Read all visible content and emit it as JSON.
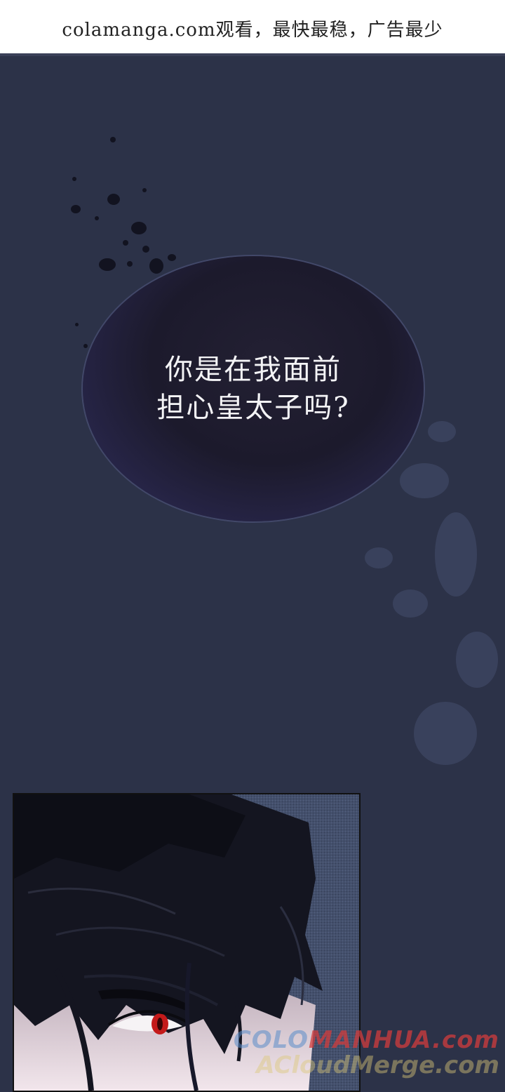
{
  "banner": {
    "text": "colamanga.com观看，最快最稳，广告最少"
  },
  "speech_bubble": {
    "line1": "你是在我面前",
    "line2": "担心皇太子吗?"
  },
  "watermark": {
    "line1_part1": "COLO",
    "line1_part2": "MANHUA.com",
    "line2": "ACloudMerge.com"
  },
  "colors": {
    "background": "#2c3248",
    "bubble": "#1c1a2c",
    "eye": "#c41a1a"
  }
}
